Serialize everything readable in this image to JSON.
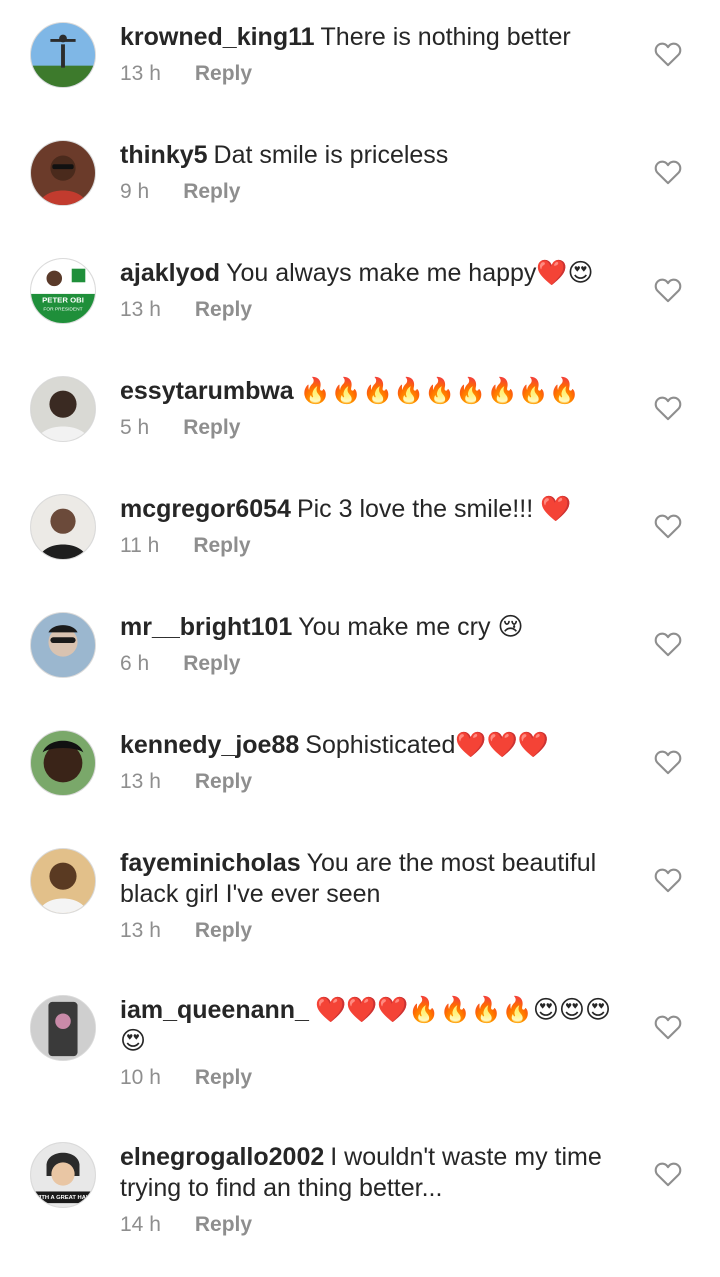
{
  "comments": [
    {
      "username": "krowned_king11",
      "text": "There is nothing better",
      "time": "13 h",
      "reply_label": "Reply",
      "avatar_colors": [
        "#7fb7e6",
        "#3d7a2c"
      ]
    },
    {
      "username": "thinky5",
      "text": "Dat smile is priceless",
      "time": "9 h",
      "reply_label": "Reply",
      "avatar_colors": [
        "#6b3b2a",
        "#c23b2e"
      ]
    },
    {
      "username": "ajaklyod",
      "text": "You always make me happy❤️😍",
      "time": "13 h",
      "reply_label": "Reply",
      "avatar_colors": [
        "#ffffff",
        "#1f8f3a"
      ],
      "avatar_caption_1": "PETER OBI",
      "avatar_caption_2": "FOR PRESIDENT"
    },
    {
      "username": "essytarumbwa",
      "text": "🔥🔥🔥🔥🔥🔥🔥🔥🔥",
      "time": "5 h",
      "reply_label": "Reply",
      "avatar_colors": [
        "#d9d9d4",
        "#3a2a22"
      ]
    },
    {
      "username": "mcgregor6054",
      "text": "Pic 3 love the smile!!! ❤️",
      "time": "11 h",
      "reply_label": "Reply",
      "avatar_colors": [
        "#eceae6",
        "#6b4a3a"
      ]
    },
    {
      "username": "mr__bright101",
      "text": "You make me cry 😢",
      "time": "6 h",
      "reply_label": "Reply",
      "avatar_colors": [
        "#9bb7cf",
        "#d9c3b1"
      ]
    },
    {
      "username": "kennedy_joe88",
      "text": "Sophisticated❤️❤️❤️",
      "time": "13 h",
      "reply_label": "Reply",
      "avatar_colors": [
        "#7aa86a",
        "#3a2418"
      ]
    },
    {
      "username": "fayeminicholas",
      "text": "You are the most beautiful black girl I've ever seen",
      "time": "13 h",
      "reply_label": "Reply",
      "avatar_colors": [
        "#e2c08a",
        "#5a3a22"
      ]
    },
    {
      "username": "iam_queenann_",
      "text": "❤️❤️❤️🔥🔥🔥🔥😍😍😍😍",
      "time": "10 h",
      "reply_label": "Reply",
      "avatar_colors": [
        "#cfcfcf",
        "#c98aa8"
      ]
    },
    {
      "username": "elnegrogallo2002",
      "text": "I wouldn't waste my time trying to find an thing better...",
      "time": "14 h",
      "reply_label": "Reply",
      "avatar_colors": [
        "#e8e8e8",
        "#2a2a2a"
      ],
      "avatar_caption_1": "WITH A GREAT HAIR"
    }
  ],
  "icons": {
    "avatar": "avatar",
    "like": "heart-outline-icon"
  },
  "colors": {
    "text": "#262626",
    "meta": "#8e8e8e",
    "icon": "#8e8e8e",
    "background": "#ffffff"
  }
}
